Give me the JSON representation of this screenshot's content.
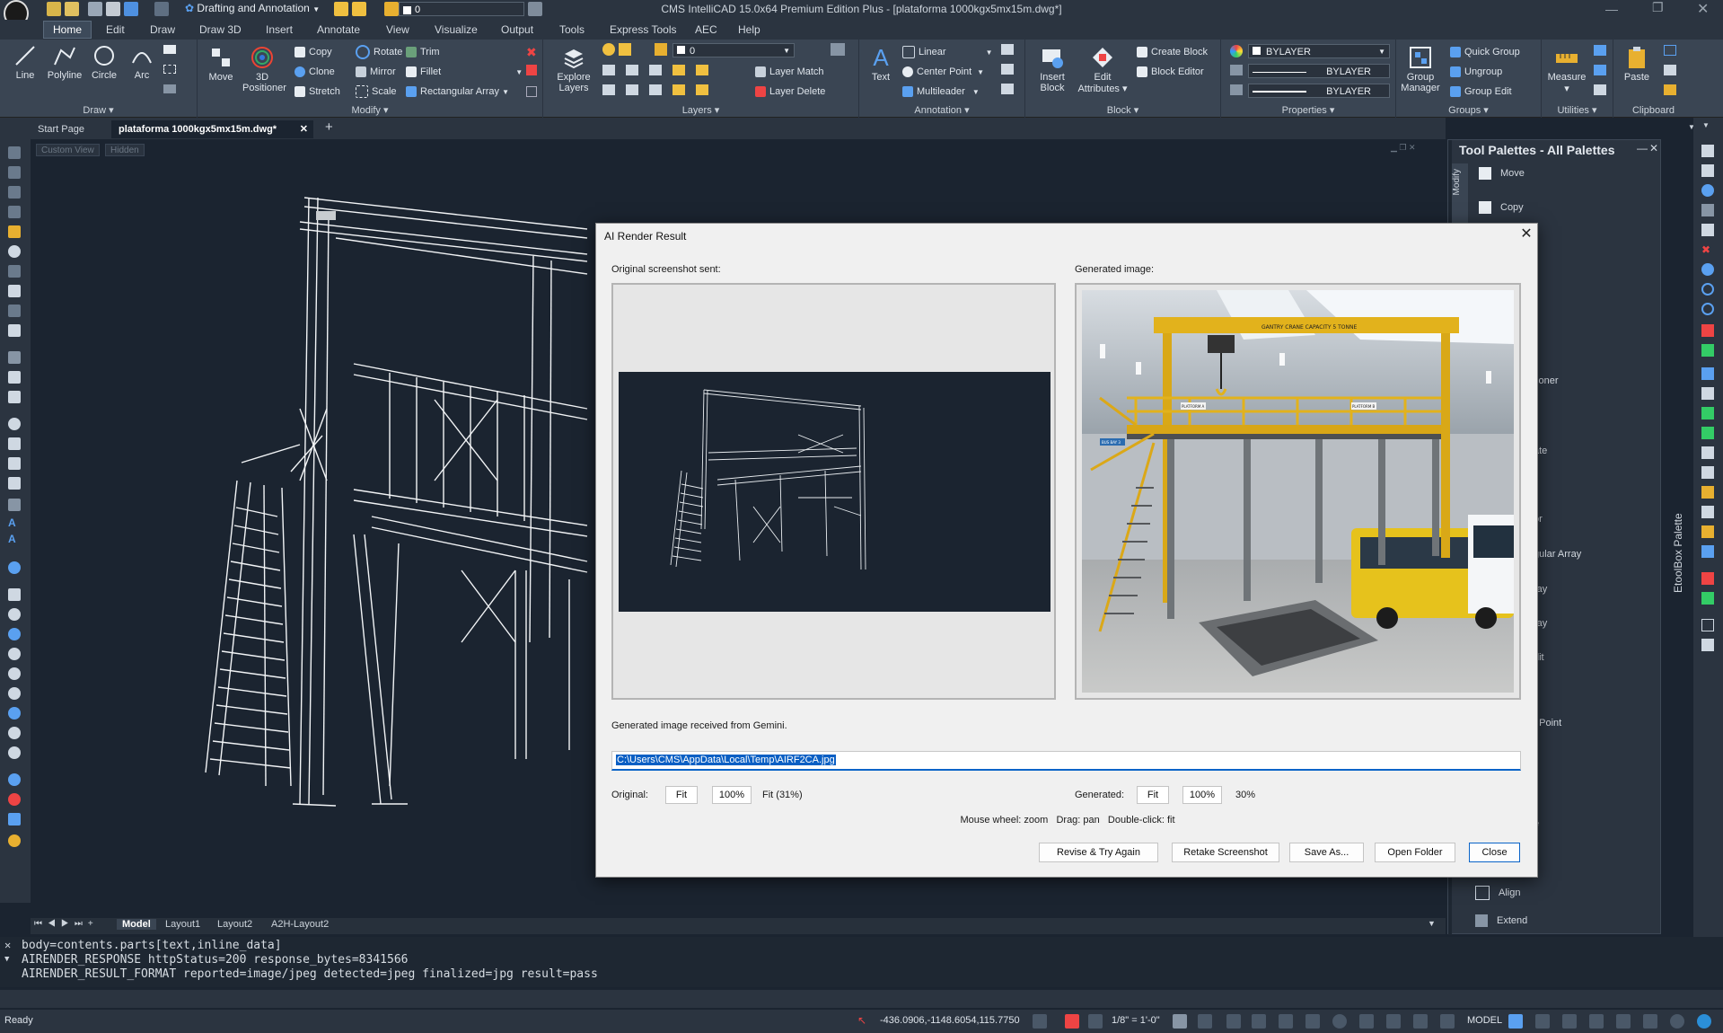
{
  "app": {
    "title": "CMS IntelliCAD 15.0x64 Premium Edition Plus  - [plataforma 1000kgx5mx15m.dwg*]",
    "workspace": "Drafting and Annotation",
    "layer_qa": "0"
  },
  "menu": [
    "Home",
    "Edit",
    "Draw",
    "Draw 3D",
    "Insert",
    "Annotate",
    "View",
    "Visualize",
    "Output",
    "Tools",
    "Express Tools",
    "AEC",
    "Help"
  ],
  "ribbon": {
    "draw": {
      "label": "Draw",
      "line": "Line",
      "polyline": "Polyline",
      "circle": "Circle",
      "arc": "Arc"
    },
    "modify": {
      "label": "Modify",
      "move": "Move",
      "positioner_1": "3D",
      "positioner_2": "Positioner",
      "copy": "Copy",
      "rotate": "Rotate",
      "trim": "Trim",
      "clone": "Clone",
      "mirror": "Mirror",
      "fillet": "Fillet",
      "stretch": "Stretch",
      "scale": "Scale",
      "rect_array": "Rectangular Array"
    },
    "layers": {
      "label": "Layers",
      "explore_1": "Explore",
      "explore_2": "Layers",
      "layer_value": "0",
      "layer_match": "Layer Match",
      "layer_delete": "Layer Delete"
    },
    "annotation": {
      "label": "Annotation",
      "text": "Text",
      "linear": "Linear",
      "center_point": "Center Point",
      "multileader": "Multileader"
    },
    "block": {
      "label": "Block",
      "insert_1": "Insert",
      "insert_2": "Block",
      "edit_1": "Edit",
      "edit_2": "Attributes",
      "create": "Create Block",
      "editor": "Block Editor"
    },
    "properties": {
      "label": "Properties",
      "color": "BYLAYER",
      "linetype": "BYLAYER",
      "lineweight": "BYLAYER"
    },
    "groups": {
      "label": "Groups",
      "manager_1": "Group",
      "manager_2": "Manager",
      "quick": "Quick Group",
      "ungroup": "Ungroup",
      "edit": "Group Edit"
    },
    "utilities": {
      "label": "Utilities",
      "measure": "Measure"
    },
    "clipboard": {
      "label": "Clipboard",
      "paste": "Paste"
    }
  },
  "doc_tabs": {
    "start": "Start Page",
    "drawing": "plataforma 1000kgx5mx15m.dwg*"
  },
  "viewport": {
    "custom_view": "Custom View",
    "hidden": "Hidden"
  },
  "palette": {
    "title": "Tool Palettes - All Palettes",
    "side_tab": "Modify",
    "items": [
      "Move",
      "Copy"
    ],
    "partial": [
      "tioner",
      "ate",
      "or",
      "gular Array",
      "ray",
      "ray",
      "dit",
      "t Point",
      "e"
    ],
    "bottom": [
      "Align",
      "Extend"
    ],
    "etool": "EtoolBox Palette"
  },
  "layout_tabs": [
    "Model",
    "Layout1",
    "Layout2",
    "A2H-Layout2"
  ],
  "cmdline": [
    "body=contents.parts[text,inline_data]",
    "AIRENDER_RESPONSE httpStatus=200 response_bytes=8341566",
    "AIRENDER_RESULT_FORMAT reported=image/jpeg detected=jpeg finalized=jpg result=pass"
  ],
  "status": {
    "ready": "Ready",
    "coords": "-436.0906,-1148.6054,115.7750",
    "scale": "1/8\" = 1'-0\"",
    "model": "MODEL"
  },
  "dialog": {
    "title": "AI Render Result",
    "original_label": "Original screenshot sent:",
    "generated_label": "Generated image:",
    "message": "Generated image received from Gemini.",
    "path": "C:\\Users\\CMS\\AppData\\Local\\Temp\\AIRF2CA.jpg",
    "original_text": "Original:",
    "fit": "Fit",
    "hundred": "100%",
    "original_fit": "Fit (31%)",
    "generated_text": "Generated:",
    "generated_zoom": "30%",
    "hint": "Mouse wheel: zoom   Drag: pan   Double-click: fit",
    "btn_revise": "Revise & Try Again",
    "btn_retake": "Retake Screenshot",
    "btn_saveas": "Save As...",
    "btn_open": "Open Folder",
    "btn_close": "Close",
    "render_texts": {
      "crane": "GANTRY CRANE CAPACITY 5 TONNE",
      "platform_a": "PLATFORM A",
      "platform_b": "PLATFORM B",
      "bay": "BUS BAY 3"
    }
  },
  "colors": {
    "ui_dark": "#2b3440",
    "viewport": "#1b2430",
    "accent": "#0a64c8",
    "steel_yellow": "#e2b21c"
  }
}
